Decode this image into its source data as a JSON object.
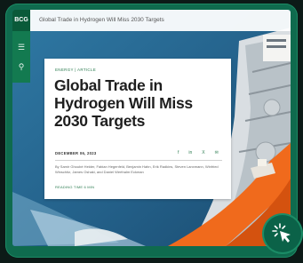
{
  "app": {
    "logo_text": "BCG",
    "page_title": "Global Trade in Hydrogen Will Miss 2030 Targets"
  },
  "rail": {
    "icons": [
      "menu-icon",
      "search-icon"
    ],
    "menu_glyph": "☰",
    "search_glyph": "⚲"
  },
  "article": {
    "eyebrow": "ENERGY | ARTICLE",
    "headline": "Global Trade in Hydrogen Will Miss 2030 Targets",
    "date": "DECEMBER 06, 2023",
    "share_icons": [
      {
        "name": "facebook-icon",
        "glyph": "f"
      },
      {
        "name": "linkedin-icon",
        "glyph": "in"
      },
      {
        "name": "x-icon",
        "glyph": "X"
      },
      {
        "name": "email-icon",
        "glyph": "✉"
      }
    ],
    "authors": "By Samir Ghoubé Helder, Fabian Hegenfeld, Benjamin Hahn, Erik Radkins, Steven Lanxmann, Winfried Winschitz, James Oshaki, and Daniel Werthalm Eckman",
    "reading_time": "READING TIME 6 MIN"
  },
  "badge": {
    "icon": "cursor-click-icon"
  },
  "colors": {
    "frame": "#0f6b4e",
    "rail": "#137a50",
    "accent": "#2e7d52",
    "hull_orange": "#f06a1c"
  }
}
